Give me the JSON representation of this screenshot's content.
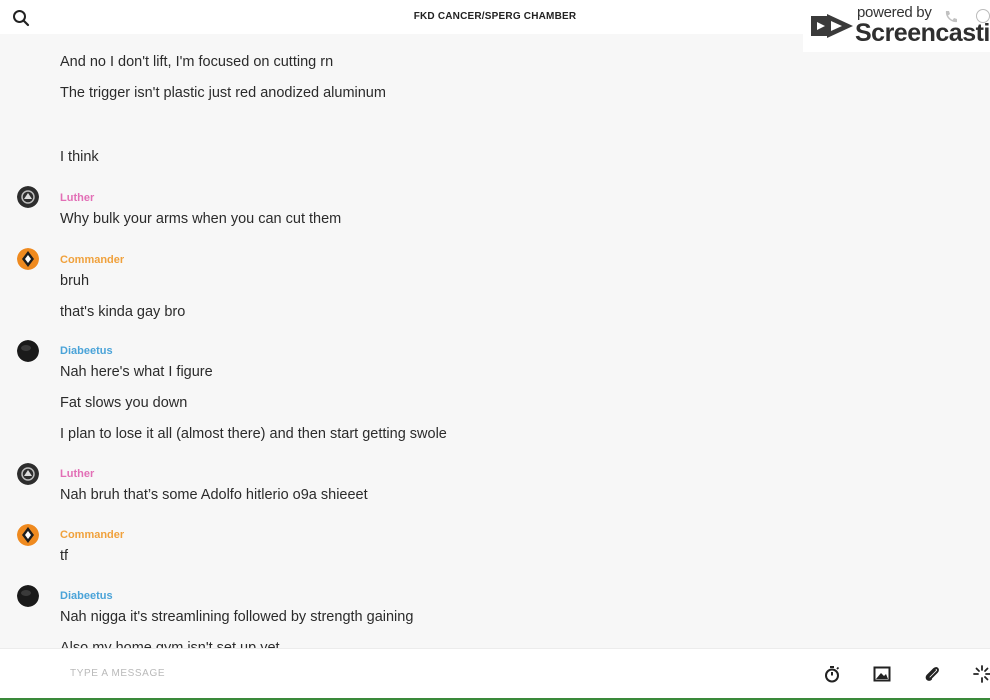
{
  "header": {
    "title": "FKD CANCER/SPERG CHAMBER",
    "search_icon": "search-icon"
  },
  "watermark": {
    "powered": "powered by",
    "brand": "Screencastify",
    "icon": "screencastify-logo"
  },
  "messages": [
    {
      "text": "And no I don't lift, I'm focused on cutting rn"
    },
    {
      "text": "The trigger isn't plastic just red anodized aluminum"
    },
    {
      "text": "I think"
    },
    {
      "author": "Luther",
      "text": "Why bulk your arms when you can cut them"
    },
    {
      "author": "Commander",
      "text": "bruh"
    },
    {
      "text": "that's kinda gay bro"
    },
    {
      "author": "Diabeetus",
      "text": "Nah here's what I figure"
    },
    {
      "text": "Fat slows you down"
    },
    {
      "text": "I plan to lose it all (almost there) and then start getting swole"
    },
    {
      "author": "Luther",
      "text": "Nah bruh that’s some Adolfo hitlerio o9a shieeet"
    },
    {
      "author": "Commander",
      "text": "tf"
    },
    {
      "author": "Diabeetus",
      "text": "Nah nigga it's streamlining followed by strength gaining"
    },
    {
      "text": "Also my home gym isn't set up yet"
    }
  ],
  "composer": {
    "placeholder": "TYPE A MESSAGE",
    "tools": [
      "timer-icon",
      "image-icon",
      "paperclip-icon",
      "sparkle-icon"
    ]
  },
  "colors": {
    "luther": "#e26fb6",
    "commander": "#f0a13c",
    "diabeetus": "#4aa3d8",
    "background": "#f7f7f7"
  }
}
